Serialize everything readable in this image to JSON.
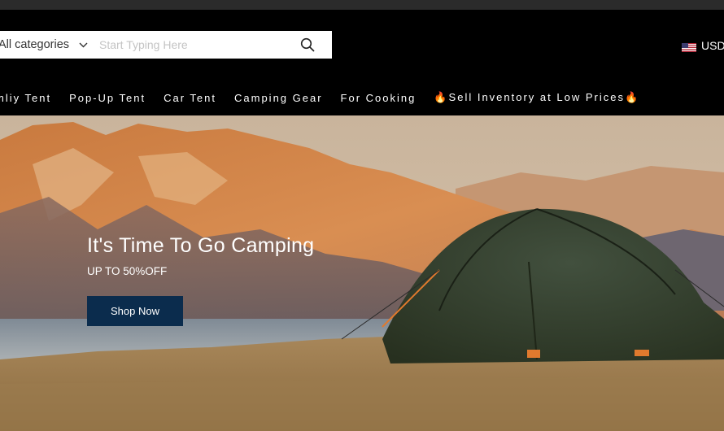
{
  "search": {
    "category_label": "All categories",
    "placeholder": "Start Typing Here"
  },
  "currency": {
    "label": "USD",
    "flag_icon": "us-flag-icon"
  },
  "nav": {
    "items": [
      {
        "label": "mliy Tent"
      },
      {
        "label": "Pop-Up Tent"
      },
      {
        "label": "Car Tent"
      },
      {
        "label": "Camping Gear"
      },
      {
        "label": "For Cooking"
      },
      {
        "label": "🔥Sell Inventory at Low Prices🔥"
      }
    ]
  },
  "hero": {
    "title": "It's Time To Go Camping",
    "subtitle": "UP TO 50%OFF",
    "cta_label": "Shop Now"
  },
  "colors": {
    "header_bg": "#000000",
    "cta_bg": "#0b2c4d",
    "search_bg": "#ffffff"
  }
}
